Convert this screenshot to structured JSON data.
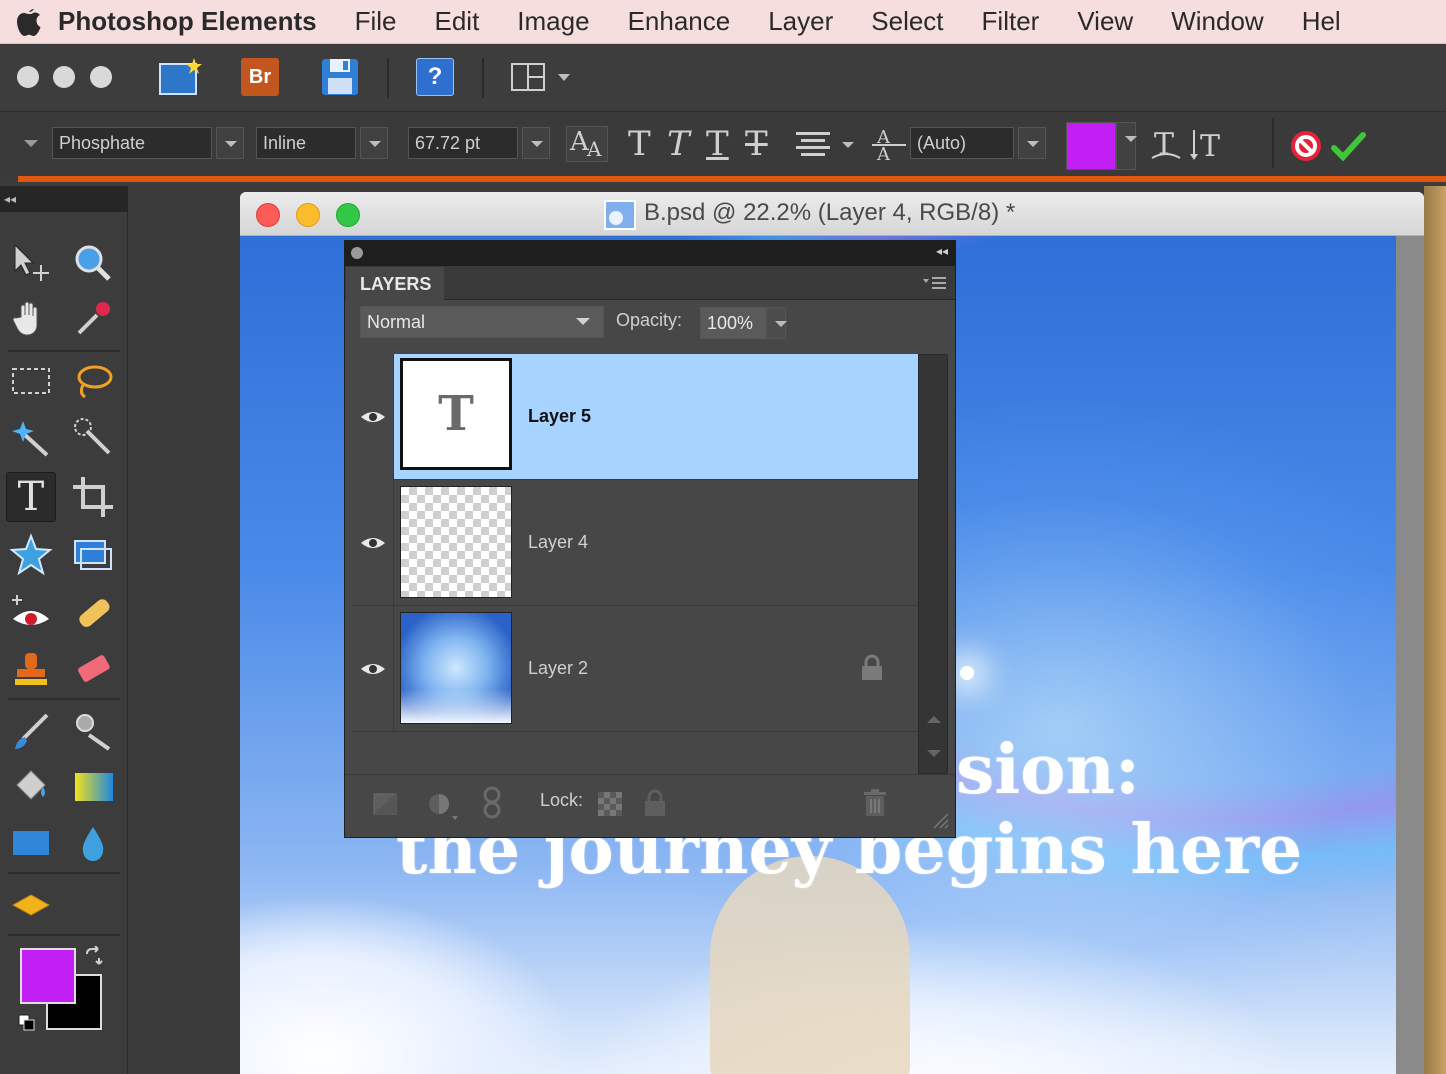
{
  "menubar": {
    "app_name": "Photoshop Elements",
    "items": [
      "File",
      "Edit",
      "Image",
      "Enhance",
      "Layer",
      "Select",
      "Filter",
      "View",
      "Window",
      "Hel"
    ]
  },
  "toolbar": {
    "bridge_label": "Br",
    "help_label": "?"
  },
  "options": {
    "font_family": "Phosphate",
    "font_style": "Inline",
    "font_size": "67.72 pt",
    "leading": "(Auto)",
    "text_color": "#c21ff4"
  },
  "toolpanel": {
    "collapse_label": "◂◂",
    "foreground_color": "#c21ff4",
    "background_color": "#000000"
  },
  "document": {
    "title": "B.psd @ 22.2% (Layer 4, RGB/8) *",
    "canvas_text_line1": "sion:",
    "canvas_text_line2": "the journey begins here"
  },
  "layers_panel": {
    "tab_label": "LAYERS",
    "collapse_label": "◂◂",
    "blend_mode": "Normal",
    "opacity_label": "Opacity:",
    "opacity_value": "100%",
    "lock_label": "Lock:",
    "layers": [
      {
        "name": "Layer 5",
        "thumb_glyph": "T",
        "selected": true,
        "locked": false
      },
      {
        "name": "Layer 4",
        "selected": false,
        "locked": false
      },
      {
        "name": "Layer 2",
        "selected": false,
        "locked": true
      }
    ]
  },
  "colors": {
    "accent_orange": "#e2570f",
    "selected_layer": "#a6d3ff"
  }
}
